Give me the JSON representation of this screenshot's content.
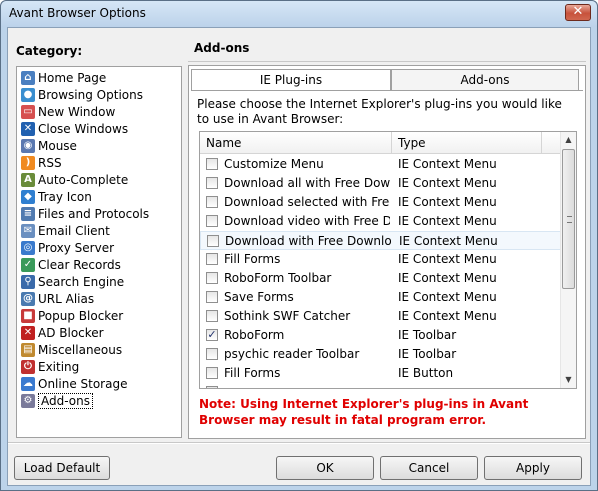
{
  "window": {
    "title": "Avant Browser Options",
    "close_label": "✕"
  },
  "category": {
    "title": "Category:",
    "items": [
      {
        "label": "Home Page",
        "icon": "home-icon",
        "color": "#4a7fc0",
        "glyph": "⌂"
      },
      {
        "label": "Browsing Options",
        "icon": "globe-icon",
        "color": "#3a8fd0",
        "glyph": "●"
      },
      {
        "label": "New Window",
        "icon": "window-icon",
        "color": "#d65050",
        "glyph": "▭"
      },
      {
        "label": "Close Windows",
        "icon": "close-window-icon",
        "color": "#2060b0",
        "glyph": "✕"
      },
      {
        "label": "Mouse",
        "icon": "mouse-icon",
        "color": "#5a78b0",
        "glyph": "◉"
      },
      {
        "label": "RSS",
        "icon": "rss-icon",
        "color": "#f08a20",
        "glyph": ")"
      },
      {
        "label": "Auto-Complete",
        "icon": "auto-complete-icon",
        "color": "#6a8c3a",
        "glyph": "A"
      },
      {
        "label": "Tray Icon",
        "icon": "tray-icon",
        "color": "#2f7fd0",
        "glyph": "◆"
      },
      {
        "label": "Files and Protocols",
        "icon": "files-icon",
        "color": "#507ab0",
        "glyph": "≡"
      },
      {
        "label": "Email Client",
        "icon": "email-icon",
        "color": "#6a8fc0",
        "glyph": "✉"
      },
      {
        "label": "Proxy Server",
        "icon": "proxy-icon",
        "color": "#3a7acc",
        "glyph": "◎"
      },
      {
        "label": "Clear Records",
        "icon": "clear-records-icon",
        "color": "#3a9a5a",
        "glyph": "✓"
      },
      {
        "label": "Search Engine",
        "icon": "search-icon",
        "color": "#3a6aaa",
        "glyph": "⚲"
      },
      {
        "label": "URL Alias",
        "icon": "url-alias-icon",
        "color": "#4a7ab0",
        "glyph": "@"
      },
      {
        "label": "Popup Blocker",
        "icon": "popup-blocker-icon",
        "color": "#c83a3a",
        "glyph": "■"
      },
      {
        "label": "AD Blocker",
        "icon": "ad-blocker-icon",
        "color": "#c02020",
        "glyph": "✕"
      },
      {
        "label": "Miscellaneous",
        "icon": "misc-icon",
        "color": "#c08a30",
        "glyph": "▤"
      },
      {
        "label": "Exiting",
        "icon": "exit-icon",
        "color": "#c03030",
        "glyph": "⏻"
      },
      {
        "label": "Online Storage",
        "icon": "storage-icon",
        "color": "#3a7ad0",
        "glyph": "☁"
      },
      {
        "label": "Add-ons",
        "icon": "addons-icon",
        "color": "#7a7a9a",
        "glyph": "⚙"
      }
    ],
    "selected_index": 19
  },
  "panel": {
    "title": "Add-ons",
    "tabs": [
      {
        "label": "IE Plug-ins",
        "active": true
      },
      {
        "label": "Add-ons",
        "active": false
      }
    ],
    "instructions": "Please choose the Internet Explorer's plug-ins you would like to use in Avant Browser:",
    "columns": [
      "Name",
      "Type"
    ],
    "plugins": [
      {
        "name": "Customize Menu",
        "type": "IE Context Menu",
        "checked": false
      },
      {
        "name": "Download all with Free Downl...",
        "type": "IE Context Menu",
        "checked": false
      },
      {
        "name": "Download selected with Free ...",
        "type": "IE Context Menu",
        "checked": false
      },
      {
        "name": "Download video with Free Do...",
        "type": "IE Context Menu",
        "checked": false
      },
      {
        "name": "Download with Free Downloa...",
        "type": "IE Context Menu",
        "checked": false,
        "hover": true
      },
      {
        "name": "Fill Forms",
        "type": "IE Context Menu",
        "checked": false
      },
      {
        "name": "RoboForm Toolbar",
        "type": "IE Context Menu",
        "checked": false
      },
      {
        "name": "Save Forms",
        "type": "IE Context Menu",
        "checked": false
      },
      {
        "name": "Sothink SWF Catcher",
        "type": "IE Context Menu",
        "checked": false
      },
      {
        "name": "RoboForm",
        "type": "IE Toolbar",
        "checked": true
      },
      {
        "name": "psychic reader Toolbar",
        "type": "IE Toolbar",
        "checked": false
      },
      {
        "name": "Fill Forms",
        "type": "IE Button",
        "checked": false
      },
      {
        "name": "",
        "type": "",
        "checked": false
      }
    ],
    "warning": "Note: Using Internet Explorer's plug-ins in Avant Browser may result in fatal program error."
  },
  "buttons": {
    "load_default": "Load Default",
    "ok": "OK",
    "cancel": "Cancel",
    "apply": "Apply"
  },
  "colors": {
    "warning": "#e00000",
    "frame": "#bcd3ea"
  }
}
